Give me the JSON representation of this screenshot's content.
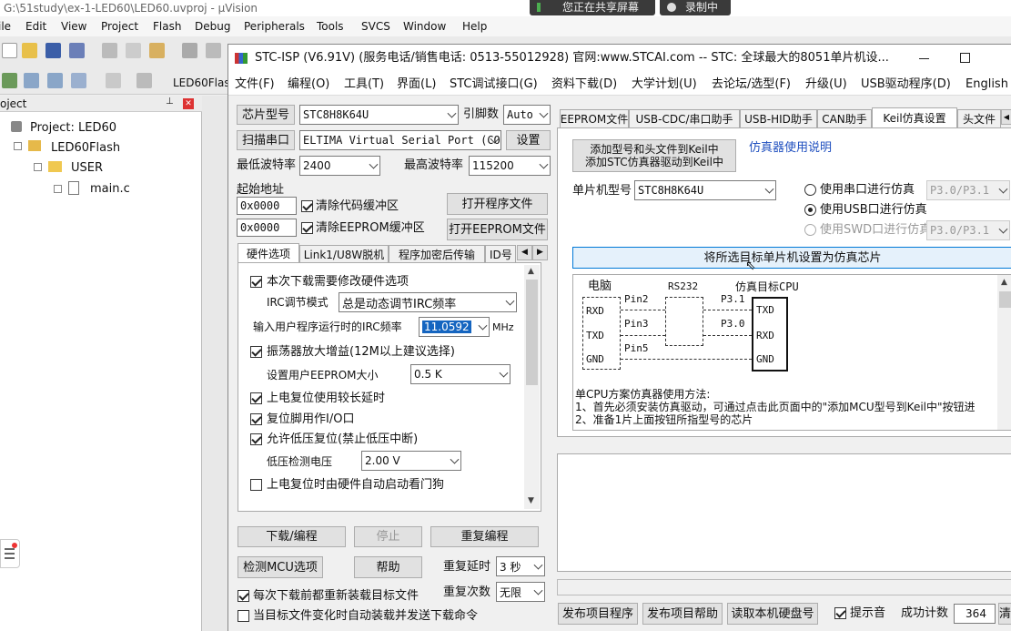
{
  "overlay": {
    "share": "您正在共享屏幕",
    "record": "录制中"
  },
  "uv": {
    "title": "G:\\51study\\ex-1-LED60\\LED60.uvproj - µVision",
    "menu": [
      "ile",
      "Edit",
      "View",
      "Project",
      "Flash",
      "Debug",
      "Peripherals",
      "Tools",
      "SVCS",
      "Window",
      "Help"
    ],
    "target": "LED60Flas",
    "panel_title": "oject",
    "tree": [
      "Project: LED60",
      "LED60Flash",
      "USER",
      "main.c"
    ]
  },
  "win": {
    "title": "STC-ISP (V6.91V) (服务电话/销售电话: 0513-55012928) 官网:www.STCAI.com  -- STC: 全球最大的8051单片机设...",
    "menu": [
      "文件(F)",
      "编程(O)",
      "工具(T)",
      "界面(L)",
      "STC调试接口(G)",
      "资料下载(D)",
      "大学计划(U)",
      "去论坛/选型(F)",
      "升级(U)",
      "USB驱动程序(D)",
      "English"
    ],
    "chip_label": "芯片型号",
    "chip": "STC8H8K64U",
    "pins_label": "引脚数",
    "pins": "Auto",
    "scan_label": "扫描串口",
    "port": "ELTIMA Virtual Serial Port (CO",
    "settings": "设置",
    "min_baud_label": "最低波特率",
    "min_baud": "2400",
    "max_baud_label": "最高波特率",
    "max_baud": "115200",
    "start_addr_label": "起始地址",
    "addr1": "0x0000",
    "clear_code": "清除代码缓冲区",
    "open_prog": "打开程序文件",
    "addr2": "0x0000",
    "clear_eeprom": "清除EEPROM缓冲区",
    "open_eeprom": "打开EEPROM文件",
    "left_tabs": [
      "硬件选项",
      "Link1/U8W脱机",
      "程序加密后传输",
      "ID号"
    ],
    "hw": {
      "modify": "本次下载需要修改硬件选项",
      "irc_mode_label": "IRC调节模式",
      "irc_mode": "总是动态调节IRC频率",
      "irc_freq_label": "输入用户程序运行时的IRC频率",
      "irc_freq": "11.0592",
      "mhz": "MHz",
      "osc": "振荡器放大增益(12M以上建议选择)",
      "eeprom_label": "设置用户EEPROM大小",
      "eeprom": "0.5 K",
      "por_delay": "上电复位使用较长延时",
      "reset_io": "复位脚用作I/O口",
      "lvr": "允许低压复位(禁止低压中断)",
      "lvd_label": "低压检测电压",
      "lvd": "2.00 V",
      "wdt": "上电复位时由硬件自动启动看门狗"
    },
    "download": "下载/编程",
    "stop": "停止",
    "reprog": "重复编程",
    "check_mcu": "检测MCU选项",
    "help": "帮助",
    "delay_label": "重复延时",
    "delay": "3 秒",
    "count_label": "重复次数",
    "count": "无限",
    "reload": "每次下载前都重新装载目标文件",
    "auto_send": "当目标文件变化时自动装载并发送下载命令",
    "right_tabs": [
      "EEPROM文件",
      "USB-CDC/串口助手",
      "USB-HID助手",
      "CAN助手",
      "Keil仿真设置",
      "头文件"
    ],
    "keil": {
      "add_btn1": "添加型号和头文件到Keil中",
      "add_btn2": "添加STC仿真器驱动到Keil中",
      "manual": "仿真器使用说明",
      "mcu_label": "单片机型号",
      "mcu": "STC8H8K64U",
      "opt_serial": "使用串口进行仿真",
      "serial_pins": "P3.0/P3.1",
      "opt_usb": "使用USB口进行仿真",
      "opt_swd": "使用SWD口进行仿真",
      "swd_pins": "P3.0/P3.1",
      "set_chip": "将所选目标单片机设置为仿真芯片"
    },
    "diagram": {
      "pc": "电脑",
      "rs232": "RS232",
      "target": "仿真目标CPU",
      "rxd": "RXD",
      "txd": "TXD",
      "gnd": "GND",
      "pin2": "Pin2",
      "pin3": "Pin3",
      "pin5": "Pin5",
      "p31": "P3.1",
      "p30": "P3.0",
      "note1": "单CPU方案仿真器使用方法:",
      "note2": "1、首先必须安装仿真驱动，可通过点击此页面中的\"添加MCU型号到Keil中\"按钮进",
      "note3": "2、准备1片上面按钮所指型号的芯片"
    },
    "publish": "发布项目程序",
    "publish_help": "发布项目帮助",
    "read_disk": "读取本机硬盘号",
    "beep": "提示音",
    "success_label": "成功计数",
    "success": "364",
    "clear": "清"
  }
}
